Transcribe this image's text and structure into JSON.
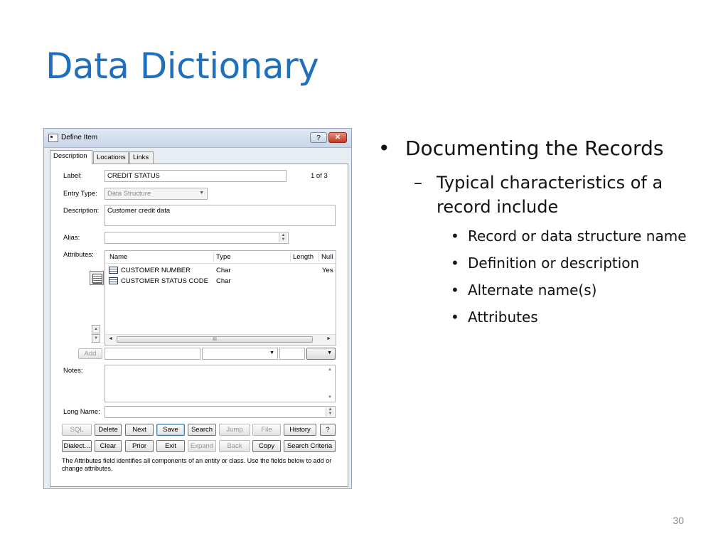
{
  "slide": {
    "title": "Data Dictionary",
    "page_number": "30",
    "bullets": {
      "l1": "Documenting the Records",
      "l2": "Typical characteristics of a record include",
      "l3": [
        "Record or data structure name",
        "Definition or description",
        "Alternate name(s)",
        "Attributes"
      ]
    }
  },
  "dialog": {
    "title": "Define Item",
    "help_glyph": "?",
    "close_glyph": "✕",
    "tabs": [
      "Description",
      "Locations",
      "Links"
    ],
    "labels": {
      "label": "Label:",
      "entry_type": "Entry Type:",
      "description": "Description:",
      "alias": "Alias:",
      "attributes": "Attributes:",
      "notes": "Notes:",
      "long_name": "Long Name:"
    },
    "values": {
      "label": "CREDIT STATUS",
      "counter": "1 of 3",
      "entry_type": "Data Structure",
      "description": "Customer credit data",
      "alias": "",
      "notes": "",
      "long_name": ""
    },
    "attributes_table": {
      "headers": [
        "Name",
        "Type",
        "Length",
        "Null"
      ],
      "rows": [
        {
          "name": "CUSTOMER NUMBER",
          "type": "Char",
          "length": "",
          "null": "Yes"
        },
        {
          "name": "CUSTOMER STATUS CODE",
          "type": "Char",
          "length": "",
          "null": ""
        }
      ],
      "scroll_thumb": "III"
    },
    "add_button": "Add",
    "buttons_row1": [
      "SQL",
      "Delete",
      "Next",
      "Save",
      "Search",
      "Jump",
      "File",
      "History",
      "?"
    ],
    "buttons_row2": [
      "Dialect...",
      "Clear",
      "Prior",
      "Exit",
      "Expand",
      "Back",
      "Copy",
      "Search Criteria"
    ],
    "hint": "The Attributes field identifies all components of an entity or class. Use the fields below to add or change attributes."
  }
}
